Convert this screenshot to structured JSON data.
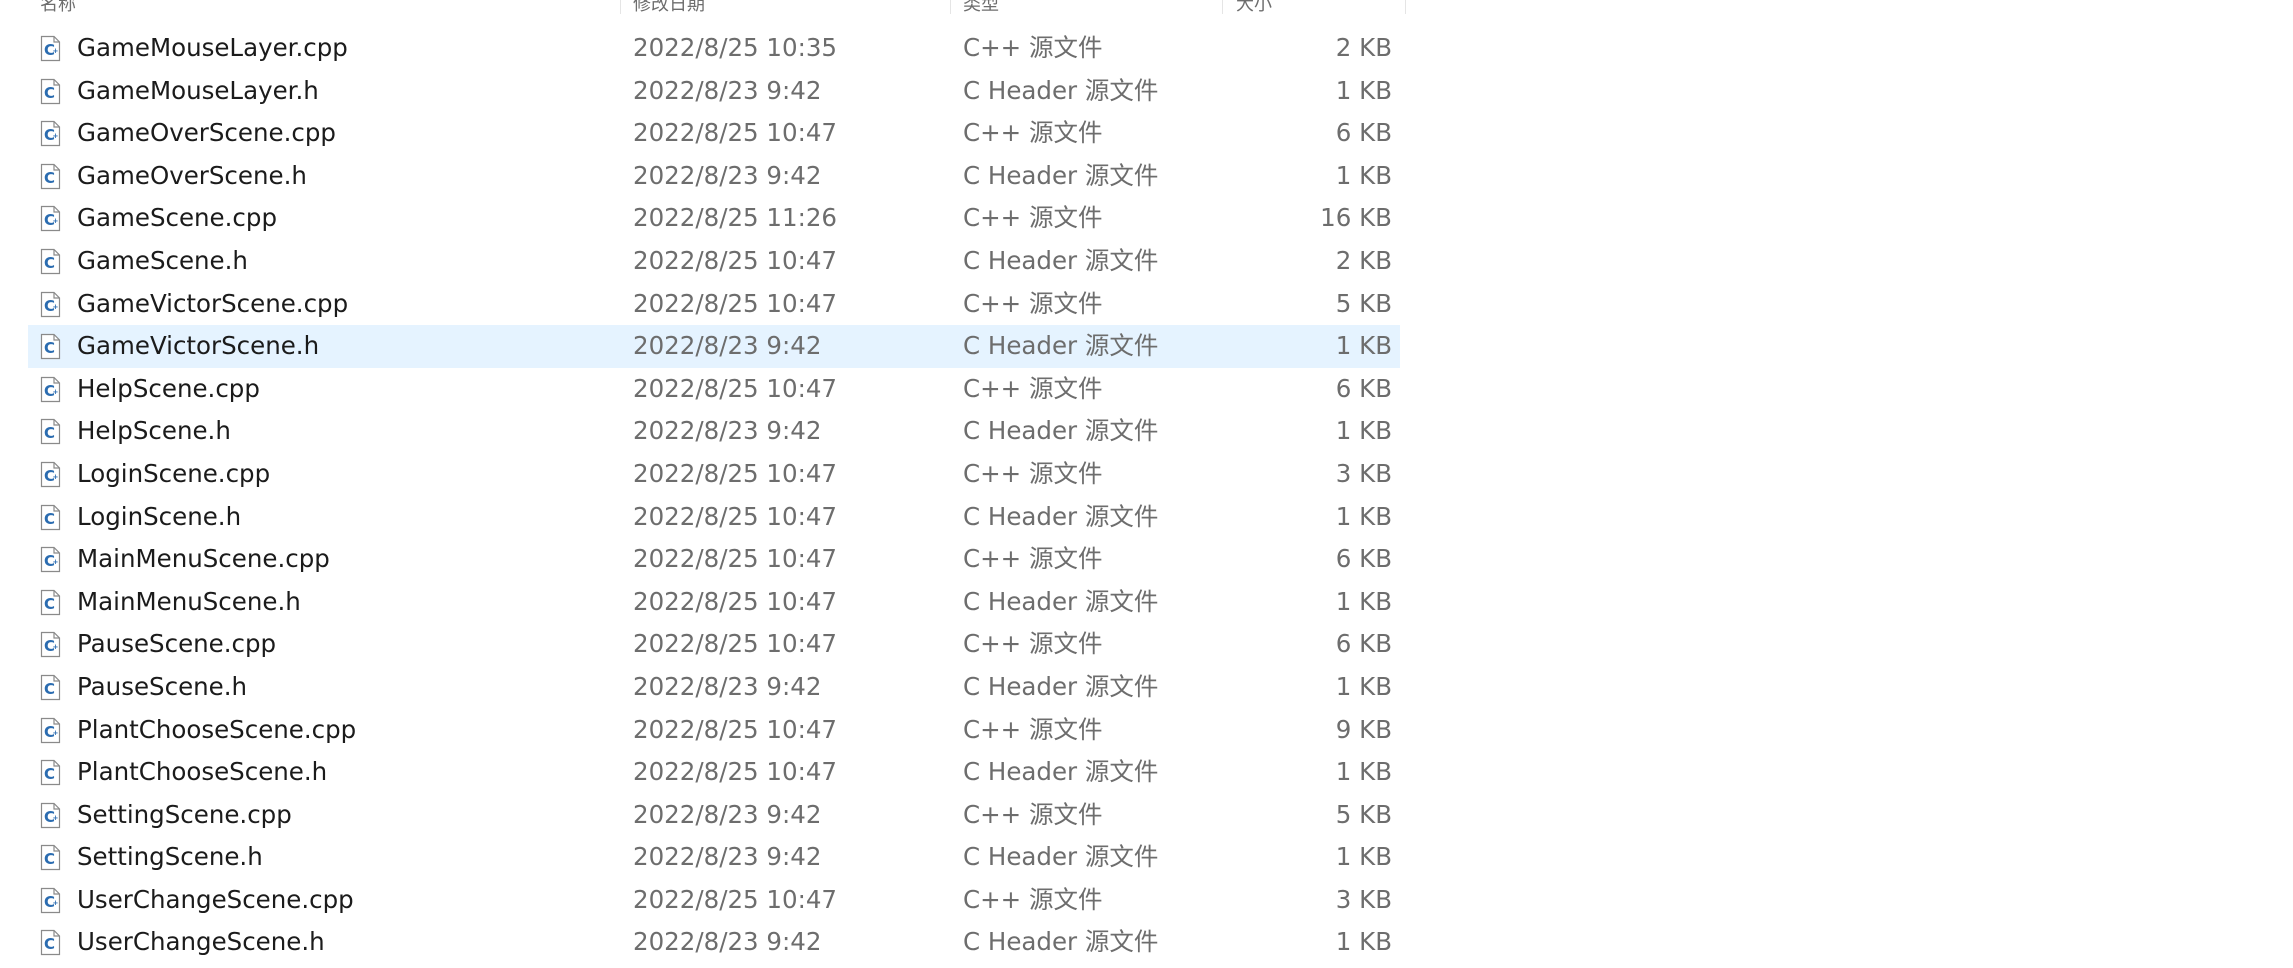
{
  "columns": {
    "name": "名称",
    "date": "修改日期",
    "type": "类型",
    "size": "大小"
  },
  "selected_index": 7,
  "files": [
    {
      "name": "GameMouseLayer.cpp",
      "date": "2022/8/25 10:35",
      "type": "C++ 源文件",
      "size": "2 KB",
      "icon": "cpp-file-icon"
    },
    {
      "name": "GameMouseLayer.h",
      "date": "2022/8/23 9:42",
      "type": "C Header 源文件",
      "size": "1 KB",
      "icon": "header-file-icon"
    },
    {
      "name": "GameOverScene.cpp",
      "date": "2022/8/25 10:47",
      "type": "C++ 源文件",
      "size": "6 KB",
      "icon": "cpp-file-icon"
    },
    {
      "name": "GameOverScene.h",
      "date": "2022/8/23 9:42",
      "type": "C Header 源文件",
      "size": "1 KB",
      "icon": "header-file-icon"
    },
    {
      "name": "GameScene.cpp",
      "date": "2022/8/25 11:26",
      "type": "C++ 源文件",
      "size": "16 KB",
      "icon": "cpp-file-icon"
    },
    {
      "name": "GameScene.h",
      "date": "2022/8/25 10:47",
      "type": "C Header 源文件",
      "size": "2 KB",
      "icon": "header-file-icon"
    },
    {
      "name": "GameVictorScene.cpp",
      "date": "2022/8/25 10:47",
      "type": "C++ 源文件",
      "size": "5 KB",
      "icon": "cpp-file-icon"
    },
    {
      "name": "GameVictorScene.h",
      "date": "2022/8/23 9:42",
      "type": "C Header 源文件",
      "size": "1 KB",
      "icon": "header-file-icon"
    },
    {
      "name": "HelpScene.cpp",
      "date": "2022/8/25 10:47",
      "type": "C++ 源文件",
      "size": "6 KB",
      "icon": "cpp-file-icon"
    },
    {
      "name": "HelpScene.h",
      "date": "2022/8/23 9:42",
      "type": "C Header 源文件",
      "size": "1 KB",
      "icon": "header-file-icon"
    },
    {
      "name": "LoginScene.cpp",
      "date": "2022/8/25 10:47",
      "type": "C++ 源文件",
      "size": "3 KB",
      "icon": "cpp-file-icon"
    },
    {
      "name": "LoginScene.h",
      "date": "2022/8/25 10:47",
      "type": "C Header 源文件",
      "size": "1 KB",
      "icon": "header-file-icon"
    },
    {
      "name": "MainMenuScene.cpp",
      "date": "2022/8/25 10:47",
      "type": "C++ 源文件",
      "size": "6 KB",
      "icon": "cpp-file-icon"
    },
    {
      "name": "MainMenuScene.h",
      "date": "2022/8/25 10:47",
      "type": "C Header 源文件",
      "size": "1 KB",
      "icon": "header-file-icon"
    },
    {
      "name": "PauseScene.cpp",
      "date": "2022/8/25 10:47",
      "type": "C++ 源文件",
      "size": "6 KB",
      "icon": "cpp-file-icon"
    },
    {
      "name": "PauseScene.h",
      "date": "2022/8/23 9:42",
      "type": "C Header 源文件",
      "size": "1 KB",
      "icon": "header-file-icon"
    },
    {
      "name": "PlantChooseScene.cpp",
      "date": "2022/8/25 10:47",
      "type": "C++ 源文件",
      "size": "9 KB",
      "icon": "cpp-file-icon"
    },
    {
      "name": "PlantChooseScene.h",
      "date": "2022/8/25 10:47",
      "type": "C Header 源文件",
      "size": "1 KB",
      "icon": "header-file-icon"
    },
    {
      "name": "SettingScene.cpp",
      "date": "2022/8/23 9:42",
      "type": "C++ 源文件",
      "size": "5 KB",
      "icon": "cpp-file-icon"
    },
    {
      "name": "SettingScene.h",
      "date": "2022/8/23 9:42",
      "type": "C Header 源文件",
      "size": "1 KB",
      "icon": "header-file-icon"
    },
    {
      "name": "UserChangeScene.cpp",
      "date": "2022/8/25 10:47",
      "type": "C++ 源文件",
      "size": "3 KB",
      "icon": "cpp-file-icon"
    },
    {
      "name": "UserChangeScene.h",
      "date": "2022/8/23 9:42",
      "type": "C Header 源文件",
      "size": "1 KB",
      "icon": "header-file-icon"
    }
  ]
}
